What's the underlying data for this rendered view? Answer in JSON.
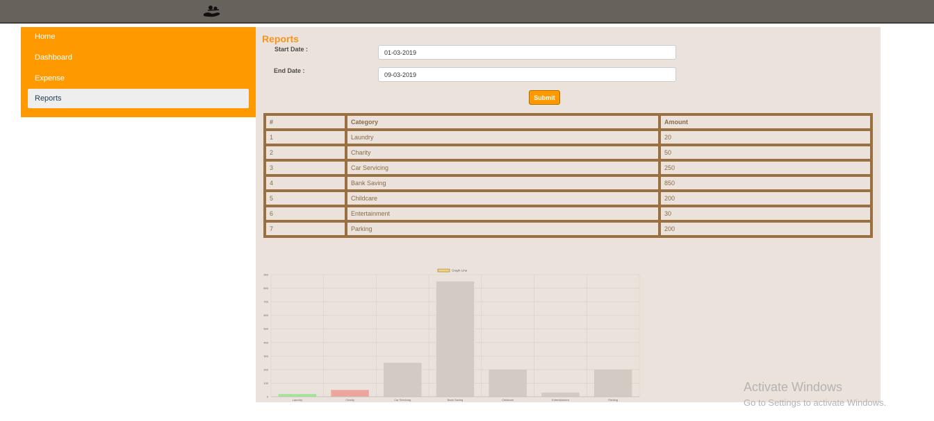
{
  "sidebar": {
    "items": [
      {
        "label": "Home"
      },
      {
        "label": "Dashboard"
      },
      {
        "label": "Expense"
      },
      {
        "label": "Reports"
      }
    ]
  },
  "main": {
    "title": "Reports",
    "start_date": {
      "label": "Start Date :",
      "value": "01-03-2019"
    },
    "end_date": {
      "label": "End Date :",
      "value": "09-03-2019"
    },
    "submit_label": "Submit",
    "table": {
      "headers": [
        "#",
        "Category",
        "Amount"
      ],
      "rows": [
        [
          "1",
          "Laundry",
          "20"
        ],
        [
          "2",
          "Charity",
          "50"
        ],
        [
          "3",
          "Car Servicing",
          "250"
        ],
        [
          "4",
          "Bank Saving",
          "850"
        ],
        [
          "5",
          "Childcare",
          "200"
        ],
        [
          "6",
          "Entertainment",
          "30"
        ],
        [
          "7",
          "Parking",
          "200"
        ]
      ]
    }
  },
  "chart_data": {
    "type": "bar",
    "title": "",
    "legend": "Graph Line",
    "legend_position": "top",
    "grid": true,
    "categories": [
      "Laundry",
      "Charity",
      "Car Servicing",
      "Bank Saving",
      "Childcare",
      "Entertainment",
      "Parking"
    ],
    "values": [
      20,
      50,
      250,
      850,
      200,
      30,
      200
    ],
    "ylim": [
      0,
      900
    ],
    "yticks": [
      0,
      100,
      200,
      300,
      400,
      500,
      600,
      700,
      800,
      900
    ],
    "colors": [
      "#a5e59a",
      "#eda59d",
      "#d3cbc3",
      "#d3cbc3",
      "#d3cbc3",
      "#d3cbc3",
      "#d3cbc3"
    ],
    "legend_color": "#f1d27a"
  },
  "watermark": {
    "line1": "Activate Windows",
    "line2": "Go to Settings to activate Windows."
  }
}
